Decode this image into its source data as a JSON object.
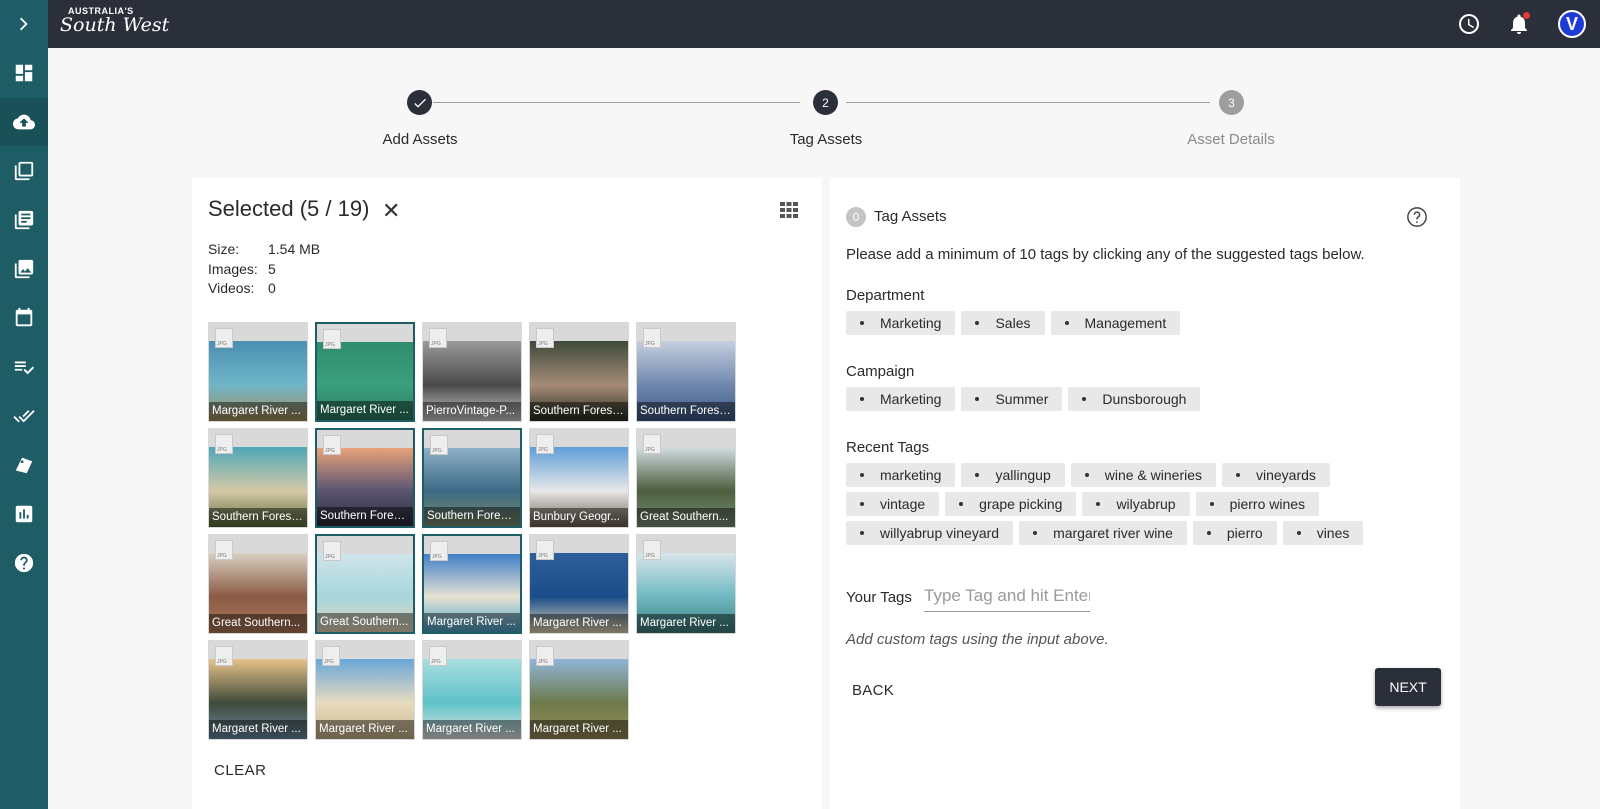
{
  "app": {
    "logo_line1": "AUSTRALIA'S",
    "logo_line2": "South West",
    "avatar_initial": "V"
  },
  "sidebar": {
    "items": [
      {
        "name": "expand-icon"
      },
      {
        "name": "dashboard-icon"
      },
      {
        "name": "upload-icon"
      },
      {
        "name": "collections-icon"
      },
      {
        "name": "articles-icon"
      },
      {
        "name": "gallery-icon"
      },
      {
        "name": "calendar-icon"
      },
      {
        "name": "playlist-check-icon"
      },
      {
        "name": "double-check-icon"
      },
      {
        "name": "tags-icon"
      },
      {
        "name": "analytics-icon"
      },
      {
        "name": "help-icon"
      }
    ]
  },
  "stepper": {
    "steps": [
      {
        "number": "1",
        "label": "Add Assets",
        "state": "done"
      },
      {
        "number": "2",
        "label": "Tag Assets",
        "state": "current"
      },
      {
        "number": "3",
        "label": "Asset Details",
        "state": "todo"
      }
    ]
  },
  "selection": {
    "title": "Selected (5 / 19)",
    "close": "✕",
    "size_label": "Size:",
    "size_value": "1.54 MB",
    "images_label": "Images:",
    "images_value": "5",
    "videos_label": "Videos:",
    "videos_value": "0",
    "clear_label": "CLEAR",
    "thumbnails": [
      {
        "caption": "Margaret River ...",
        "selected": false,
        "colors": [
          "#4a8fb0",
          "#6fb6c9",
          "#a88c5a"
        ]
      },
      {
        "caption": "Margaret River ...",
        "selected": true,
        "colors": [
          "#2f8c6e",
          "#3aa07e",
          "#2c7a60"
        ]
      },
      {
        "caption": "PierroVintage-P...",
        "selected": false,
        "colors": [
          "#9a9a9a",
          "#4a4a4a",
          "#cfcfcf"
        ]
      },
      {
        "caption": "Southern Forest...",
        "selected": false,
        "colors": [
          "#3e4a3a",
          "#a58b78",
          "#27301f"
        ]
      },
      {
        "caption": "Southern Forest...",
        "selected": false,
        "colors": [
          "#c5cfe0",
          "#6f87ad",
          "#3d5a86"
        ]
      },
      {
        "caption": "Southern Forest...",
        "selected": false,
        "colors": [
          "#4fa7b8",
          "#d6c9a6",
          "#5a6a3e"
        ]
      },
      {
        "caption": "Southern Forest...",
        "selected": true,
        "colors": [
          "#e8a27a",
          "#5b5573",
          "#2d2b3a"
        ]
      },
      {
        "caption": "Southern Forest...",
        "selected": true,
        "colors": [
          "#8fb0c8",
          "#3b6a86",
          "#7d8a6a"
        ]
      },
      {
        "caption": "Bunbury Geogr...",
        "selected": false,
        "colors": [
          "#5e9ed8",
          "#e8e8e8",
          "#6b5e4e"
        ]
      },
      {
        "caption": "Great Southern...",
        "selected": false,
        "colors": [
          "#d3dde2",
          "#4b5e3d",
          "#7d8f7a"
        ]
      },
      {
        "caption": "Great Southern...",
        "selected": false,
        "colors": [
          "#d9d0c1",
          "#8a5a44",
          "#b07a5a"
        ]
      },
      {
        "caption": "Great Southern...",
        "selected": true,
        "colors": [
          "#cfe4ea",
          "#a7d6dd",
          "#e5d6b8"
        ]
      },
      {
        "caption": "Margaret River ...",
        "selected": true,
        "colors": [
          "#3f7fc9",
          "#e7e2d3",
          "#4aa4c8"
        ]
      },
      {
        "caption": "Margaret River ...",
        "selected": false,
        "colors": [
          "#2d5f9a",
          "#1a4e8a",
          "#e6d8b6"
        ]
      },
      {
        "caption": "Margaret River ...",
        "selected": false,
        "colors": [
          "#d8e6ea",
          "#6fb8c2",
          "#3c7e7a"
        ]
      },
      {
        "caption": "Margaret River ...",
        "selected": false,
        "colors": [
          "#e8c38a",
          "#3f4a3a",
          "#6b8aa0"
        ]
      },
      {
        "caption": "Margaret River ...",
        "selected": false,
        "colors": [
          "#6aa6d8",
          "#e8dcc0",
          "#c9b48a"
        ]
      },
      {
        "caption": "Margaret River ...",
        "selected": false,
        "colors": [
          "#a9dde0",
          "#5fc2c8",
          "#e6e6e6"
        ]
      },
      {
        "caption": "Margaret River ...",
        "selected": false,
        "colors": [
          "#8fb5d8",
          "#6d7a4a",
          "#9a8a5a"
        ]
      }
    ]
  },
  "tagging": {
    "count": "0",
    "title": "Tag Assets",
    "instruction": "Please add a minimum of 10 tags by clicking any of the suggested tags below.",
    "groups": [
      {
        "label": "Department",
        "rows": [
          [
            "Marketing",
            "Sales",
            "Management"
          ]
        ]
      },
      {
        "label": "Campaign",
        "rows": [
          [
            "Marketing",
            "Summer",
            "Dunsborough"
          ]
        ]
      },
      {
        "label": "Recent Tags",
        "rows": [
          [
            "marketing",
            "yallingup",
            "wine & wineries",
            "vineyards"
          ],
          [
            "vintage",
            "grape picking",
            "wilyabrup",
            "pierro wines"
          ],
          [
            "willyabrup vineyard",
            "margaret river wine",
            "pierro",
            "vines"
          ]
        ]
      }
    ],
    "your_tags_label": "Your Tags",
    "input_placeholder": "Type Tag and hit Enter",
    "input_value": "",
    "hint": "Add custom tags using the input above.",
    "back_label": "BACK",
    "next_label": "NEXT"
  },
  "colors": {
    "sidebar": "#1f5d66",
    "topbar": "#2b2f3a",
    "accent": "#2b2f3a",
    "chip": "#e8e8e8"
  }
}
